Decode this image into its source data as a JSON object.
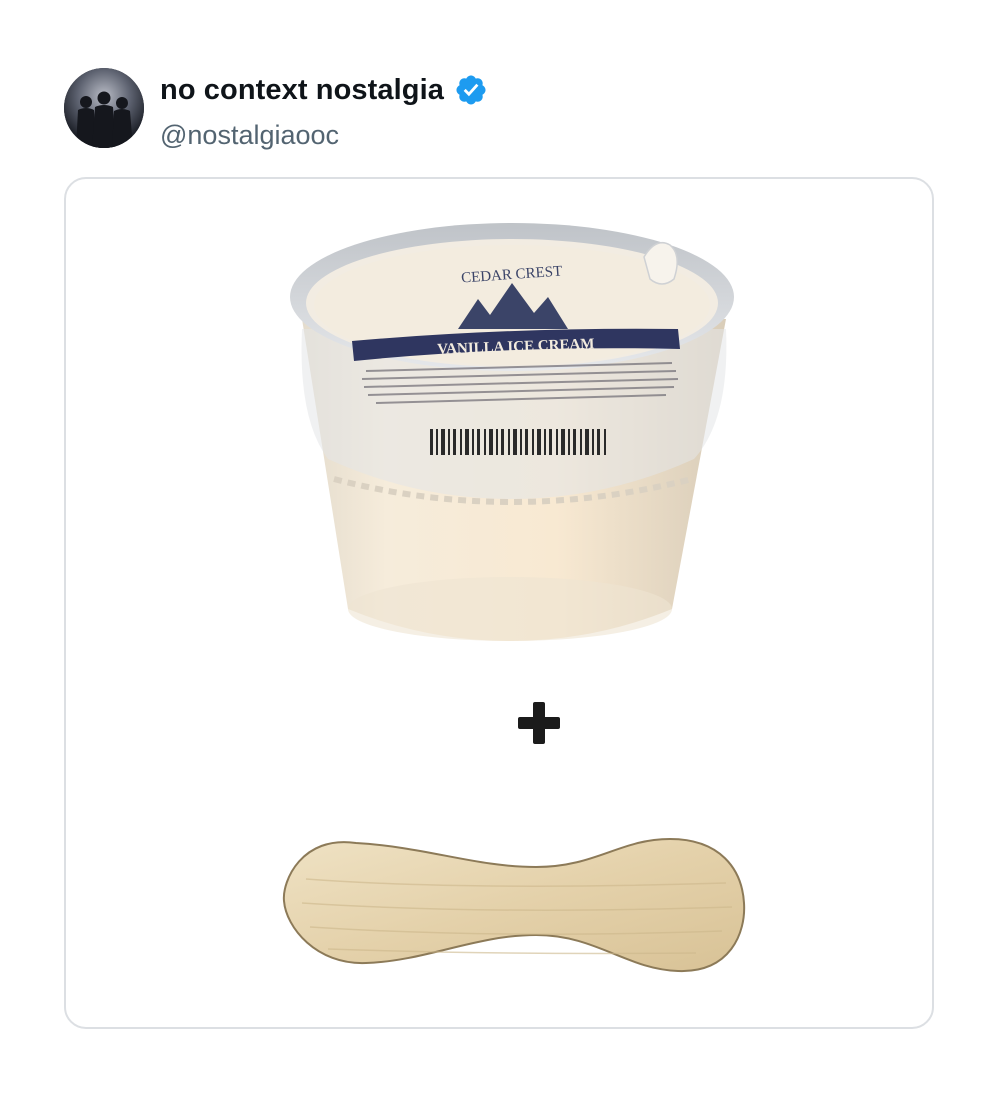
{
  "tweet": {
    "author": {
      "display_name": "no context nostalgia",
      "handle": "@nostalgiaooc",
      "verified": true,
      "verified_color": "#1d9bf0",
      "avatar_icon": "people-silhouette-avatar"
    },
    "media": {
      "cup_brand_text": "CEDAR CREST",
      "cup_product_text": "VANILLA ICE CREAM",
      "operator_symbol": "+",
      "items": [
        "ice-cream-cup",
        "wooden-spoon"
      ]
    }
  }
}
